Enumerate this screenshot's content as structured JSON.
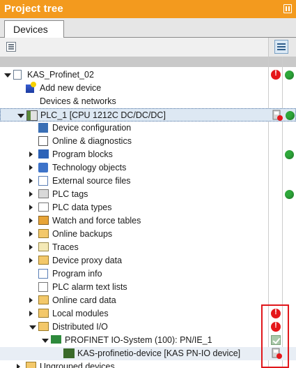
{
  "panel": {
    "title": "Project tree",
    "tab": "Devices"
  },
  "toolbar": {
    "left_icon": "overview-icon",
    "right_icon": "list-view-icon"
  },
  "colors": {
    "header": "#f39a1e",
    "error": "#e5171b",
    "ok": "#2ea83a",
    "selection": "#dde8f3",
    "highlight_box": "#e0171b"
  },
  "tree": [
    {
      "label": "KAS_Profinet_02",
      "icon": "project-icon",
      "expand": "expanded",
      "level": 0,
      "status": [
        "error",
        "ok"
      ]
    },
    {
      "label": "Add new device",
      "icon": "add-device-icon",
      "expand": "none",
      "level": 1,
      "status": []
    },
    {
      "label": "Devices & networks",
      "icon": "network-icon",
      "expand": "none",
      "level": 1,
      "status": []
    },
    {
      "label": "PLC_1 [CPU 1212C DC/DC/DC]",
      "icon": "plc-icon",
      "expand": "expanded",
      "level": 1,
      "status": [
        "download-pending",
        "ok"
      ],
      "selected": true
    },
    {
      "label": "Device configuration",
      "icon": "device-config-icon",
      "expand": "none",
      "level": 2,
      "status": []
    },
    {
      "label": "Online & diagnostics",
      "icon": "diagnostics-icon",
      "expand": "none",
      "level": 2,
      "status": []
    },
    {
      "label": "Program blocks",
      "icon": "program-blocks-icon",
      "expand": "collapsed",
      "level": 2,
      "status": [
        "ok"
      ]
    },
    {
      "label": "Technology objects",
      "icon": "technology-icon",
      "expand": "collapsed",
      "level": 2,
      "status": []
    },
    {
      "label": "External source files",
      "icon": "external-files-icon",
      "expand": "collapsed",
      "level": 2,
      "status": []
    },
    {
      "label": "PLC tags",
      "icon": "plc-tags-icon",
      "expand": "collapsed",
      "level": 2,
      "status": [
        "ok"
      ]
    },
    {
      "label": "PLC data types",
      "icon": "data-types-icon",
      "expand": "collapsed",
      "level": 2,
      "status": []
    },
    {
      "label": "Watch and force tables",
      "icon": "watch-tables-icon",
      "expand": "collapsed",
      "level": 2,
      "status": []
    },
    {
      "label": "Online backups",
      "icon": "backup-icon",
      "expand": "collapsed",
      "level": 2,
      "status": []
    },
    {
      "label": "Traces",
      "icon": "traces-icon",
      "expand": "collapsed",
      "level": 2,
      "status": []
    },
    {
      "label": "Device proxy data",
      "icon": "proxy-icon",
      "expand": "collapsed",
      "level": 2,
      "status": []
    },
    {
      "label": "Program info",
      "icon": "program-info-icon",
      "expand": "none",
      "level": 2,
      "status": []
    },
    {
      "label": "PLC alarm text lists",
      "icon": "alarm-text-icon",
      "expand": "none",
      "level": 2,
      "status": []
    },
    {
      "label": "Online card data",
      "icon": "card-data-icon",
      "expand": "collapsed",
      "level": 2,
      "status": []
    },
    {
      "label": "Local modules",
      "icon": "local-modules-icon",
      "expand": "collapsed",
      "level": 2,
      "status": [
        "error"
      ]
    },
    {
      "label": "Distributed I/O",
      "icon": "distributed-io-icon",
      "expand": "expanded",
      "level": 2,
      "status": [
        "error"
      ]
    },
    {
      "label": "PROFINET IO-System (100): PN/IE_1",
      "icon": "profinet-system-icon",
      "expand": "expanded",
      "level": 3,
      "status": [
        "check"
      ]
    },
    {
      "label": "KAS-profinetio-device [KAS PN-IO device]",
      "icon": "profinet-device-icon",
      "expand": "none",
      "level": 4,
      "status": [
        "download-pending"
      ],
      "highlight": true
    },
    {
      "label": "Ungrouped devices",
      "icon": "folder-icon",
      "expand": "collapsed",
      "level": 1,
      "status": []
    }
  ]
}
